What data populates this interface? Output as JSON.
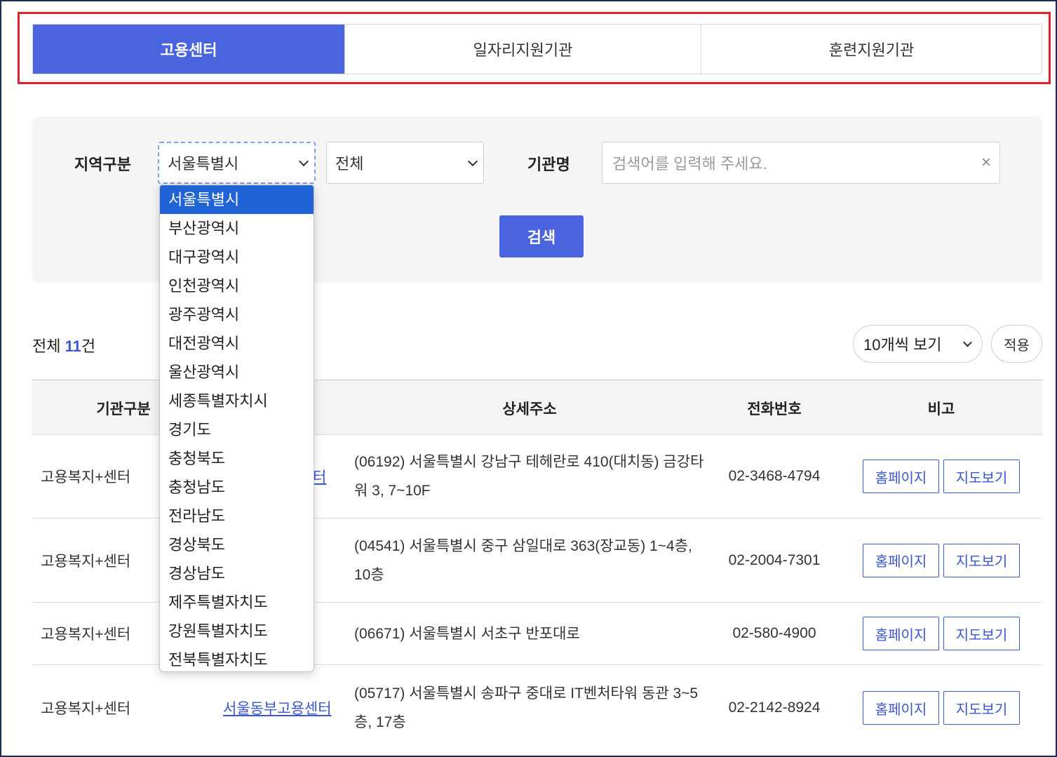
{
  "tabs": [
    {
      "label": "고용센터",
      "active": true
    },
    {
      "label": "일자리지원기관",
      "active": false
    },
    {
      "label": "훈련지원기관",
      "active": false
    }
  ],
  "search": {
    "region_label": "지역구분",
    "region_selected": "서울특별시",
    "district_selected": "전체",
    "org_label": "기관명",
    "placeholder": "검색어를 입력해 주세요.",
    "clear_glyph": "×",
    "button": "검색"
  },
  "region_options": [
    "서울특별시",
    "부산광역시",
    "대구광역시",
    "인천광역시",
    "광주광역시",
    "대전광역시",
    "울산광역시",
    "세종특별자치시",
    "경기도",
    "충청북도",
    "충청남도",
    "전라남도",
    "경상북도",
    "경상남도",
    "제주특별자치도",
    "강원특별자치도",
    "전북특별자치도"
  ],
  "results": {
    "total_prefix": "전체",
    "total_count": "11",
    "total_suffix": "건",
    "per_page": "10개씩 보기",
    "apply": "적용"
  },
  "table": {
    "headers": {
      "type": "기관구분",
      "address": "상세주소",
      "tel": "전화번호",
      "note": "비고"
    },
    "rows": [
      {
        "type": "고용복지+센터",
        "name_fragment": "터",
        "address": "(06192) 서울특별시 강남구 테헤란로 410(대치동) 금강타워 3, 7~10F",
        "tel": "02-3468-4794",
        "home": "홈페이지",
        "map": "지도보기"
      },
      {
        "type": "고용복지+센터",
        "name_fragment": "",
        "address": "(04541) 서울특별시 중구 삼일대로 363(장교동) 1~4층, 10층",
        "tel": "02-2004-7301",
        "home": "홈페이지",
        "map": "지도보기"
      },
      {
        "type": "고용복지+센터",
        "name_fragment": "",
        "address": "(06671) 서울특별시 서초구 반포대로",
        "tel": "02-580-4900",
        "home": "홈페이지",
        "map": "지도보기"
      },
      {
        "type": "고용복지+센터",
        "name_fragment": "서울동부고용센터",
        "address": "(05717) 서울특별시 송파구 중대로 IT벤처타워 동관 3~5층, 17층",
        "tel": "02-2142-8924",
        "home": "홈페이지",
        "map": "지도보기"
      }
    ]
  },
  "colors": {
    "accent": "#4a63df",
    "highlight": "#e0202a",
    "selected_option": "#1f63d6"
  }
}
